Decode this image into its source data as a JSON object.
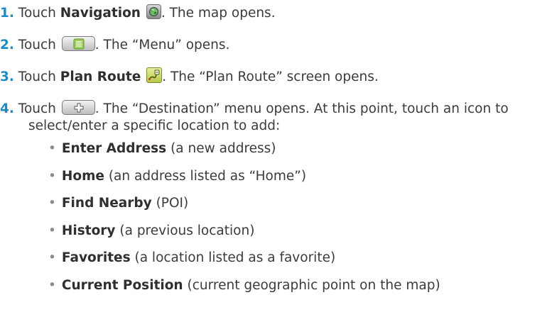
{
  "steps": [
    {
      "num": "1.",
      "pre": "Touch",
      "bold": "Navigation",
      "icon": "navigation-globe-icon",
      "post": ". The map opens."
    },
    {
      "num": "2.",
      "pre": "Touch",
      "icon": "menu-button-icon",
      "post": ". The “Menu” opens."
    },
    {
      "num": "3.",
      "pre": "Touch",
      "bold": "Plan Route",
      "icon": "plan-route-icon",
      "post": ". The “Plan Route” screen opens."
    },
    {
      "num": "4.",
      "pre": "Touch",
      "icon": "add-plus-button-icon",
      "post": ". The “Destination” menu opens. At this point, touch an icon to",
      "line2": "select/enter a specific location to add:"
    }
  ],
  "options": [
    {
      "bold": "Enter Address",
      "desc": " (a new address)"
    },
    {
      "bold": "Home",
      "desc": " (an address listed as “Home”)"
    },
    {
      "bold": "Find Nearby",
      "desc": " (POI)"
    },
    {
      "bold": "History",
      "desc": " (a previous location)"
    },
    {
      "bold": "Favorites",
      "desc": " (a location listed as a favorite)"
    },
    {
      "bold": "Current Position",
      "desc": " (current geographic point on the map)"
    }
  ],
  "bullet_char": "•",
  "colors": {
    "step_number": "#1a8bc3",
    "text": "#3b3b3b",
    "bold_text": "#2f2f2f"
  }
}
